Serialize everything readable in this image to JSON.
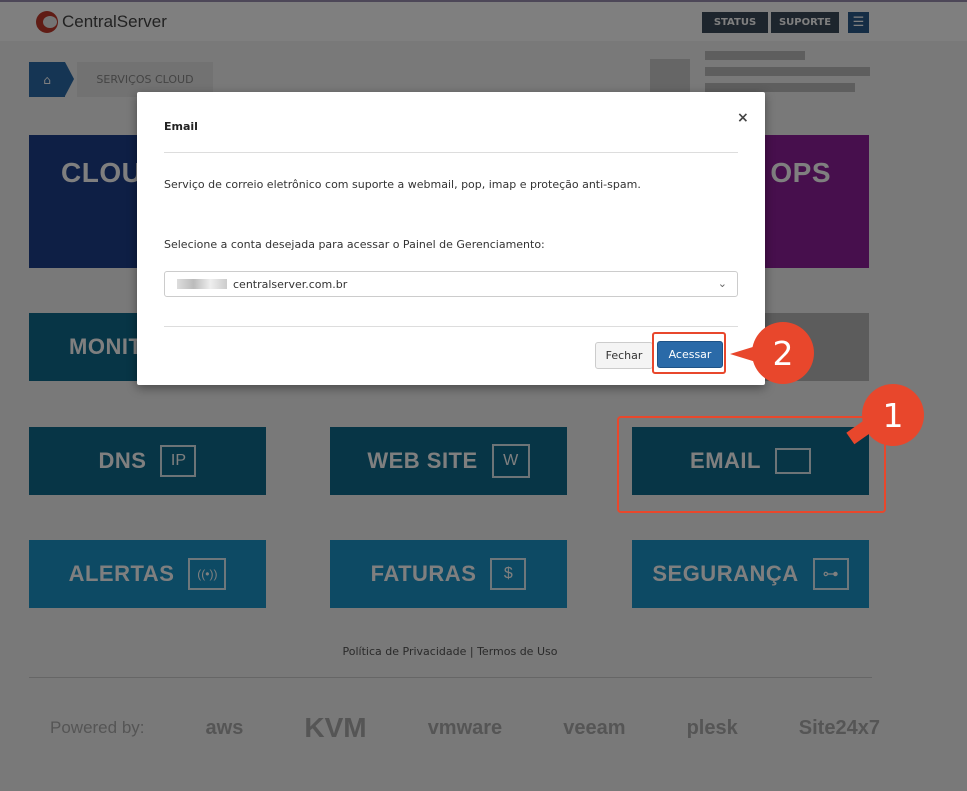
{
  "header": {
    "logo_text": "CentralServer",
    "status_label": "STATUS",
    "suporte_label": "SUPORTE",
    "menu_icon": "hamburger-icon"
  },
  "breadcrumb": {
    "home_icon": "home-icon",
    "item": "SERVIÇOS CLOUD"
  },
  "tiles": {
    "cloud": "CLOU",
    "ops": "OPS",
    "monit": "MONIT",
    "dns": "DNS",
    "dns_icon": "IP",
    "website": "WEB SITE",
    "website_icon": "W",
    "email": "EMAIL",
    "alertas": "ALERTAS",
    "alertas_icon": "((•))",
    "faturas": "FATURAS",
    "faturas_icon": "$",
    "seguranca": "SEGURANÇA",
    "seguranca_icon": "⊶"
  },
  "footer": {
    "privacy": "Política de Privacidade",
    "separator": "|",
    "terms": "Termos de Uso",
    "powered_by": "Powered by:",
    "brands": [
      "aws",
      "KVM",
      "vmware",
      "veeam",
      "plesk",
      "Site24x7"
    ]
  },
  "modal": {
    "title": "Email",
    "close": "×",
    "description": "Serviço de correio eletrônico com suporte a webmail, pop, imap e proteção anti-spam.",
    "prompt": "Selecione a conta desejada para acessar o Painel de Gerenciamento:",
    "select_value": "centralserver.com.br",
    "close_button": "Fechar",
    "submit_button": "Acessar"
  },
  "callouts": {
    "step1": "1",
    "step2": "2",
    "color": "#e8472c"
  }
}
